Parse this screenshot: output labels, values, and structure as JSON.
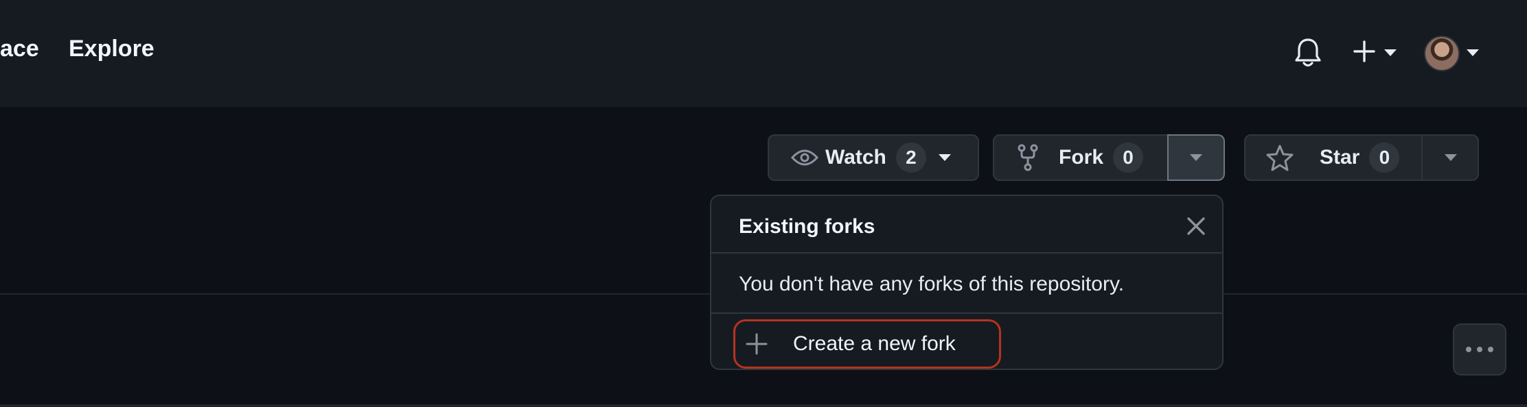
{
  "header": {
    "nav": [
      {
        "label": "ace"
      },
      {
        "label": "Explore"
      }
    ],
    "icons": {
      "notifications": "bell-icon",
      "create_new": "plus-icon",
      "avatar": "avatar"
    }
  },
  "repo_actions": {
    "watch": {
      "label": "Watch",
      "count": "2",
      "icon": "eye-icon"
    },
    "fork": {
      "label": "Fork",
      "count": "0",
      "icon": "repo-forked-icon"
    },
    "star": {
      "label": "Star",
      "count": "0",
      "icon": "star-icon"
    }
  },
  "fork_popover": {
    "title": "Existing forks",
    "message": "You don't have any forks of this repository.",
    "create_label": "Create a new fork",
    "highlight_color": "#b8331f"
  },
  "colors": {
    "background": "#0d1117",
    "header": "#161b22",
    "button": "#21262d",
    "border": "#30363d",
    "text": "#e6edf3"
  }
}
